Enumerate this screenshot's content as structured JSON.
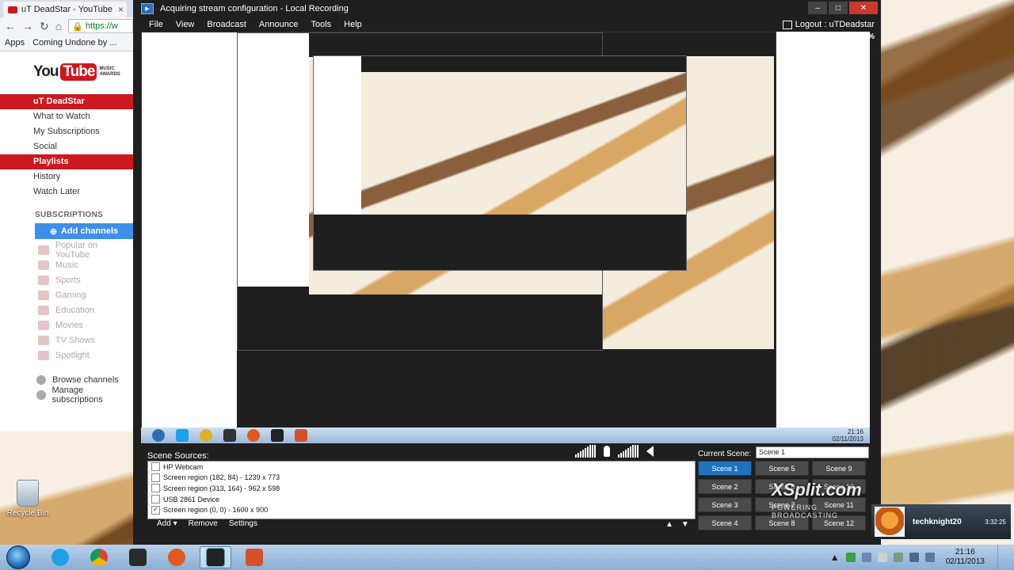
{
  "chrome": {
    "tab_title": "uT DeadStar - YouTube",
    "url": "https://w",
    "bookmarks": [
      "Apps",
      "Coming Undone by ..."
    ],
    "logo": {
      "you": "You",
      "tube": "Tube",
      "awards_line1": "MUSIC",
      "awards_line2": "AWARDS"
    },
    "menu": [
      "uT DeadStar",
      "What to Watch",
      "My Subscriptions",
      "Social",
      "Playlists",
      "History",
      "Watch Later"
    ],
    "subscriptions_heading": "SUBSCRIPTIONS",
    "add_channels": "Add channels",
    "subscriptions": [
      "Popular on YouTube",
      "Music",
      "Sports",
      "Gaming",
      "Education",
      "Movies",
      "TV Shows",
      "Spotlight"
    ],
    "footer": [
      "Browse channels",
      "Manage subscriptions"
    ]
  },
  "xsplit": {
    "title": "Acquiring stream configuration - Local Recording",
    "menu": [
      "File",
      "View",
      "Broadcast",
      "Announce",
      "Tools",
      "Help"
    ],
    "logout": "Logout : uTDeadstar",
    "zoom": "90%",
    "scene_sources_label": "Scene Sources:",
    "sources": [
      {
        "label": "HP Webcam",
        "checked": false
      },
      {
        "label": "Screen region (182, 84) - 1239 x 773",
        "checked": false
      },
      {
        "label": "Screen region (313, 164) - 962 x 598",
        "checked": false
      },
      {
        "label": "USB 2861 Device",
        "checked": false
      },
      {
        "label": "Screen region (0, 0) - 1600 x 900",
        "checked": true
      }
    ],
    "source_actions": [
      "Add",
      "Remove",
      "Settings"
    ],
    "current_scene_label": "Current Scene:",
    "current_scene": "Scene 1",
    "scenes": [
      "Scene 1",
      "Scene 5",
      "Scene 9",
      "Scene 2",
      "Scene 6",
      "Scene 10",
      "Scene 3",
      "Scene 7",
      "Scene 11",
      "Scene 4",
      "Scene 8",
      "Scene 12"
    ],
    "brand": "XSplit.com",
    "brand_sub": "POWERING BROADCASTING",
    "user": {
      "name": "techknight20",
      "time": "3:32:25"
    }
  },
  "desktop": {
    "recycle_bin": "Recycle Bin"
  },
  "taskbar": {
    "time": "21:16",
    "date": "02/11/2013"
  },
  "colors": {
    "youtube_red": "#cc181e",
    "scene_active": "#1e73be",
    "xsplit_bg": "#1f1f1f"
  }
}
